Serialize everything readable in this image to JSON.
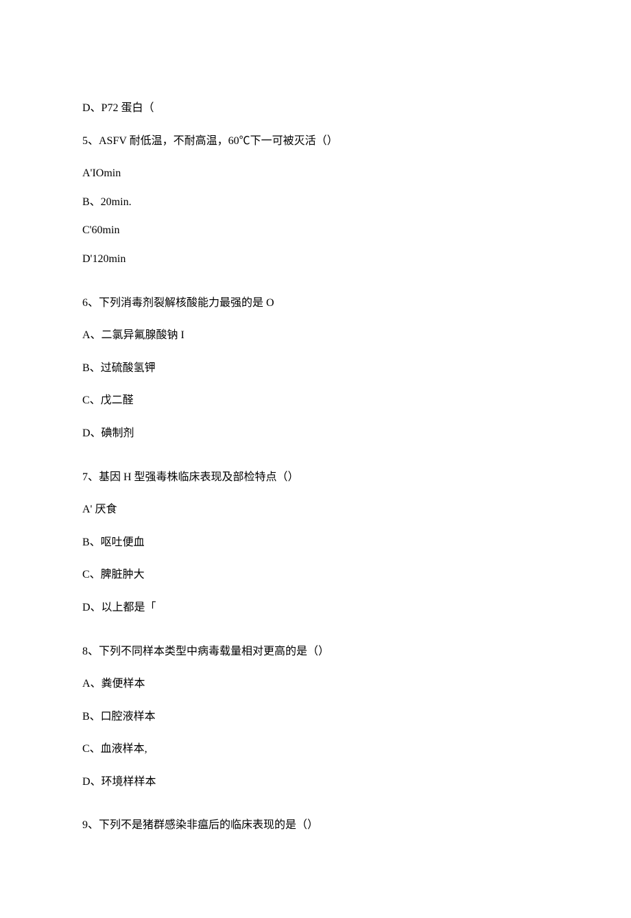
{
  "lines": [
    {
      "text": "D、P72 蛋白（",
      "gap": false,
      "tight": false
    },
    {
      "text": "5、ASFV 耐低温，不耐高温，60℃下一可被灭活（）",
      "gap": false,
      "tight": false
    },
    {
      "text": "A'IOmin",
      "gap": false,
      "tight": true
    },
    {
      "text": "B、20min.",
      "gap": false,
      "tight": true
    },
    {
      "text": "C'60min",
      "gap": false,
      "tight": true
    },
    {
      "text": "D'120min",
      "gap": false,
      "tight": false
    },
    {
      "text": "6、下列消毒剂裂解核酸能力最强的是 O",
      "gap": true,
      "tight": false
    },
    {
      "text": "A、二氯异氟腺酸钠 I",
      "gap": false,
      "tight": false
    },
    {
      "text": "B、过硫酸氢钾",
      "gap": false,
      "tight": false
    },
    {
      "text": "C、戊二醛",
      "gap": false,
      "tight": false
    },
    {
      "text": "D、碘制剂",
      "gap": false,
      "tight": false
    },
    {
      "text": "7、基因 H 型强毒株临床表现及部检特点（）",
      "gap": true,
      "tight": false
    },
    {
      "text": "A' 厌食",
      "gap": false,
      "tight": false
    },
    {
      "text": "B、呕吐便血",
      "gap": false,
      "tight": false
    },
    {
      "text": "C、脾脏肿大",
      "gap": false,
      "tight": false
    },
    {
      "text": "D、以上都是「",
      "gap": false,
      "tight": false
    },
    {
      "text": "8、下列不同样本类型中病毒载量相对更高的是（）",
      "gap": true,
      "tight": false
    },
    {
      "text": "A、粪便样本",
      "gap": false,
      "tight": false
    },
    {
      "text": "B、口腔液样本",
      "gap": false,
      "tight": false
    },
    {
      "text": "C、血液样本,",
      "gap": false,
      "tight": false
    },
    {
      "text": "D、环境样样本",
      "gap": false,
      "tight": false
    },
    {
      "text": "9、下列不是猪群感染非瘟后的临床表现的是（）",
      "gap": true,
      "tight": false
    }
  ]
}
